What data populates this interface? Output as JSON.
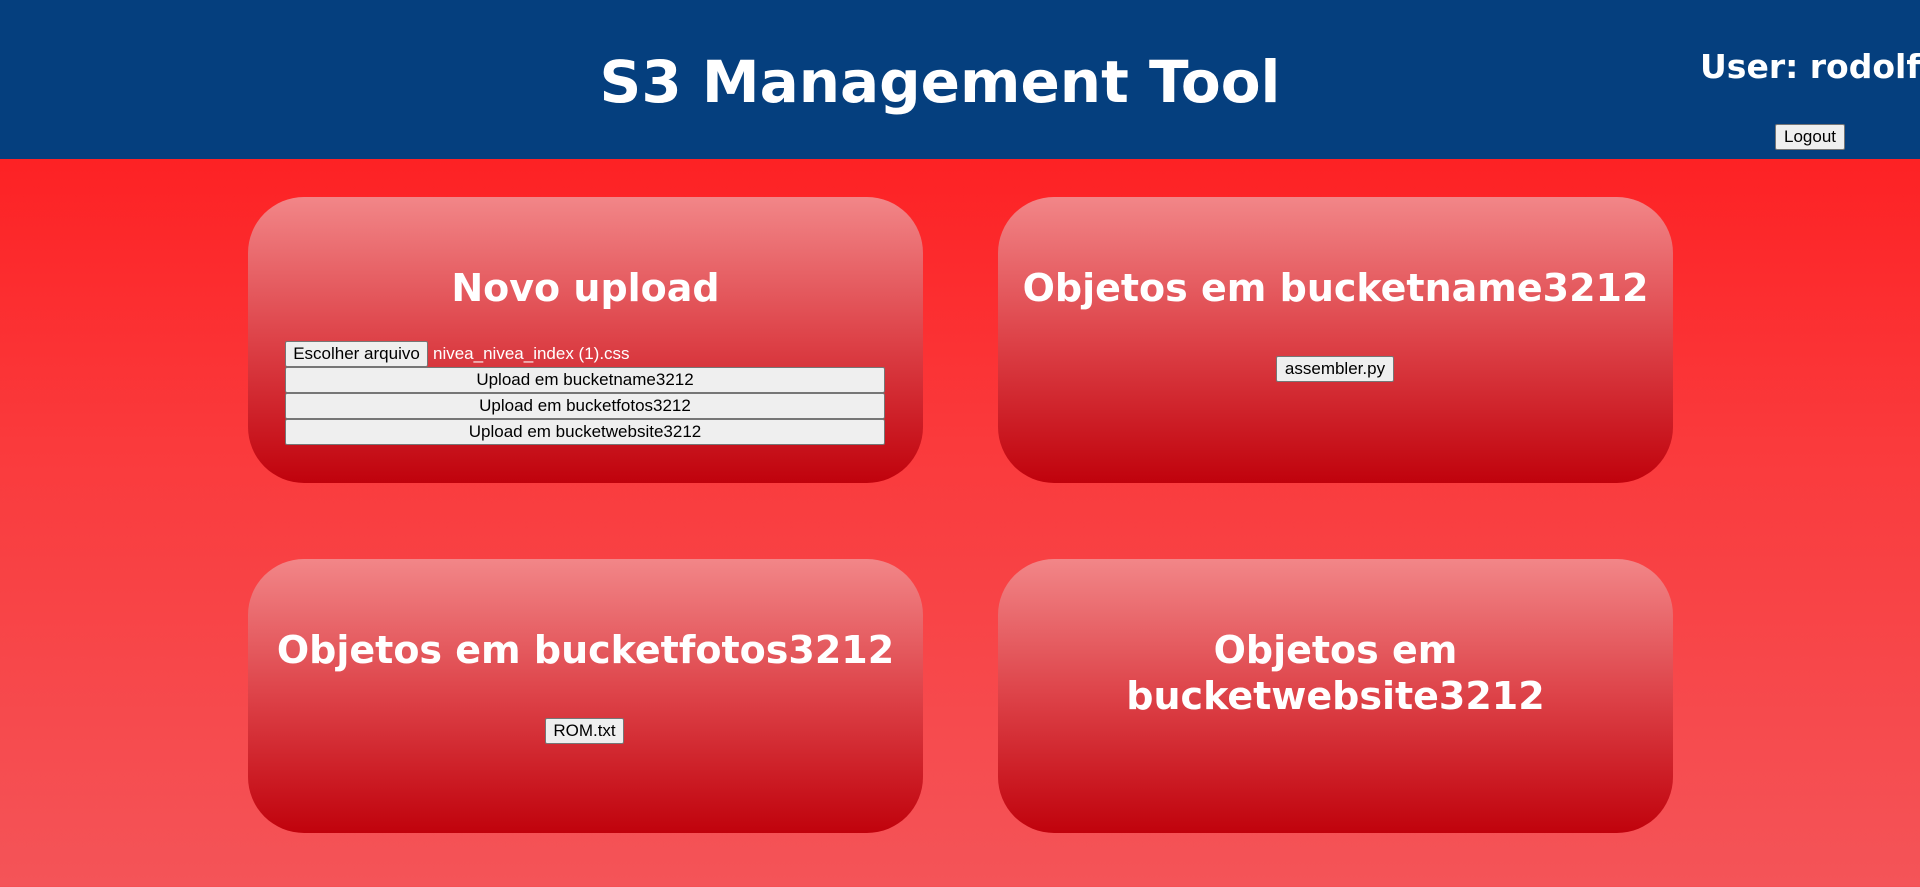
{
  "header": {
    "title": "S3 Management Tool",
    "user_label": "User: rodolfo",
    "logout_label": "Logout"
  },
  "upload_card": {
    "title": "Novo upload",
    "choose_file_label": "Escolher arquivo",
    "selected_file": "nivea_nivea_index (1).css",
    "upload_buttons": [
      "Upload em bucketname3212",
      "Upload em bucketfotos3212",
      "Upload em bucketwebsite3212"
    ]
  },
  "buckets": [
    {
      "title": "Objetos em bucketname3212",
      "objects": [
        "assembler.py"
      ]
    },
    {
      "title": "Objetos em bucketfotos3212",
      "objects": [
        "ROM.txt"
      ]
    },
    {
      "title": "Objetos em bucketwebsite3212",
      "objects": []
    }
  ],
  "colors": {
    "header_bg": "#053f7e",
    "page_bg_top": "#ff1417",
    "page_bg_bottom": "#f45458",
    "card_top": "#f28688",
    "card_bottom": "#c0020c"
  }
}
